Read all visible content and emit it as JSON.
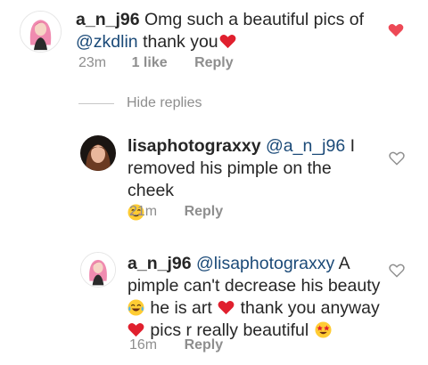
{
  "comment": {
    "username": "a_n_j96",
    "text_before": "Omg such a beautiful pics of",
    "mention": "@zkdlin",
    "text_after": " thank you",
    "emoji": "red-heart",
    "time": "23m",
    "likes": "1 like",
    "reply_label": "Reply",
    "liked": true,
    "like_color": "#ed4956"
  },
  "hide_replies_label": "Hide replies",
  "replies": [
    {
      "username": "lisaphotograxxy",
      "mention": "@a_n_j96",
      "line1_after": " I",
      "line2": "removed his pimple on the cheek",
      "emoji": "smiling-face",
      "time": "21m",
      "reply_label": "Reply",
      "liked": false
    },
    {
      "username": "a_n_j96",
      "mention": "@lisaphotograxxy",
      "line1_after": " A",
      "line2": "pimple can't decrease his beauty",
      "line3_a": " he is art ",
      "line3_b": " thank you anyway",
      "line4": " pics r really beautiful ",
      "time": "16m",
      "reply_label": "Reply",
      "liked": false
    }
  ],
  "colors": {
    "text": "#262626",
    "muted": "#8e8e8e",
    "mention": "#1b4a78",
    "heart_red": "#ed4956"
  }
}
